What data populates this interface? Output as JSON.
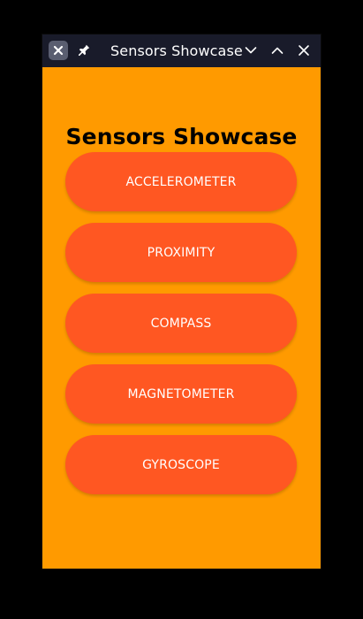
{
  "window": {
    "title": "Sensors Showcase",
    "colors": {
      "titlebar": "#191b2a",
      "background": "#ff9a00",
      "button": "#ff5722",
      "button_text": "#ffffff",
      "heading_text": "#000000"
    },
    "titlebar_icons": {
      "app": "close-x-icon",
      "pin": "pin-icon",
      "minimize": "chevron-down-icon",
      "maximize": "chevron-up-icon",
      "close": "close-icon"
    }
  },
  "main": {
    "heading": "Sensors Showcase",
    "buttons": [
      {
        "label": "ACCELEROMETER"
      },
      {
        "label": "PROXIMITY"
      },
      {
        "label": "COMPASS"
      },
      {
        "label": "MAGNETOMETER"
      },
      {
        "label": "GYROSCOPE"
      }
    ]
  }
}
